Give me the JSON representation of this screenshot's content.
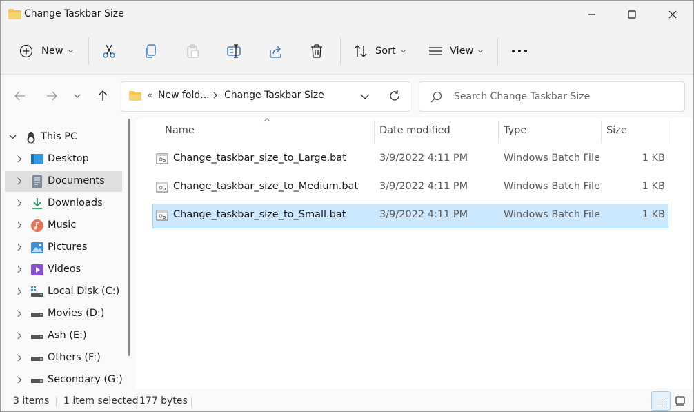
{
  "window": {
    "title": "Change Taskbar Size"
  },
  "toolbar": {
    "new_label": "New",
    "sort_label": "Sort",
    "view_label": "View"
  },
  "address": {
    "overflow_marker": "«",
    "segments": [
      "New fold...",
      "Change Taskbar Size"
    ]
  },
  "search": {
    "placeholder": "Search Change Taskbar Size"
  },
  "nav": {
    "items": [
      {
        "label": "This PC",
        "icon": "this-pc-icon"
      },
      {
        "label": "Desktop",
        "icon": "desktop-icon"
      },
      {
        "label": "Documents",
        "icon": "documents-icon"
      },
      {
        "label": "Downloads",
        "icon": "downloads-icon"
      },
      {
        "label": "Music",
        "icon": "music-icon"
      },
      {
        "label": "Pictures",
        "icon": "pictures-icon"
      },
      {
        "label": "Videos",
        "icon": "videos-icon"
      },
      {
        "label": "Local Disk (C:)",
        "icon": "local-disk-icon"
      },
      {
        "label": "Movies (D:)",
        "icon": "drive-icon"
      },
      {
        "label": "Ash (E:)",
        "icon": "drive-icon"
      },
      {
        "label": "Others (F:)",
        "icon": "drive-icon"
      },
      {
        "label": "Secondary (G:)",
        "icon": "drive-icon"
      }
    ],
    "selected": "Documents"
  },
  "files": {
    "columns": {
      "name": "Name",
      "date": "Date modified",
      "type": "Type",
      "size": "Size"
    },
    "rows": [
      {
        "name": "Change_taskbar_size_to_Large.bat",
        "date": "3/9/2022 4:11 PM",
        "type": "Windows Batch File",
        "size": "1 KB"
      },
      {
        "name": "Change_taskbar_size_to_Medium.bat",
        "date": "3/9/2022 4:11 PM",
        "type": "Windows Batch File",
        "size": "1 KB"
      },
      {
        "name": "Change_taskbar_size_to_Small.bat",
        "date": "3/9/2022 4:11 PM",
        "type": "Windows Batch File",
        "size": "1 KB"
      }
    ],
    "selected_row": 2
  },
  "status": {
    "items_count": "3 items",
    "selection": "1 item selected",
    "selection_size": "177 bytes"
  },
  "colors": {
    "selection_bg": "#cce8ff",
    "selection_border": "#99d1ff",
    "folder_yellow": "#f4c24d"
  }
}
